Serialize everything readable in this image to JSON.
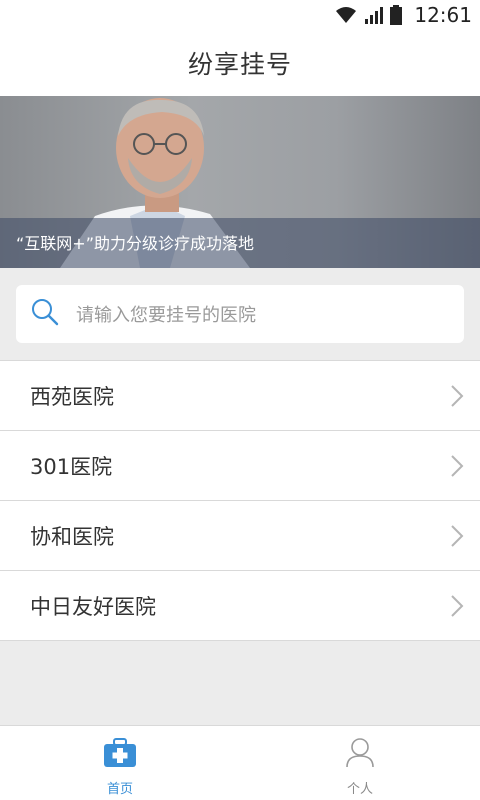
{
  "status_bar": {
    "time": "12:61",
    "icons": [
      "wifi-icon",
      "signal-icon",
      "battery-icon"
    ]
  },
  "header": {
    "title": "纷享挂号"
  },
  "banner": {
    "caption": "“互联网+”助力分级诊疗成功落地"
  },
  "search": {
    "placeholder": "请输入您要挂号的医院",
    "icon": "search-icon"
  },
  "hospitals": [
    {
      "name": "西苑医院"
    },
    {
      "name": "301医院"
    },
    {
      "name": "协和医院"
    },
    {
      "name": "中日友好医院"
    }
  ],
  "bottom_nav": {
    "tabs": [
      {
        "label": "首页",
        "icon": "medical-kit-icon",
        "active": true
      },
      {
        "label": "个人",
        "icon": "person-icon",
        "active": false
      }
    ]
  },
  "colors": {
    "accent": "#3a8fd6",
    "background": "#ececec"
  }
}
